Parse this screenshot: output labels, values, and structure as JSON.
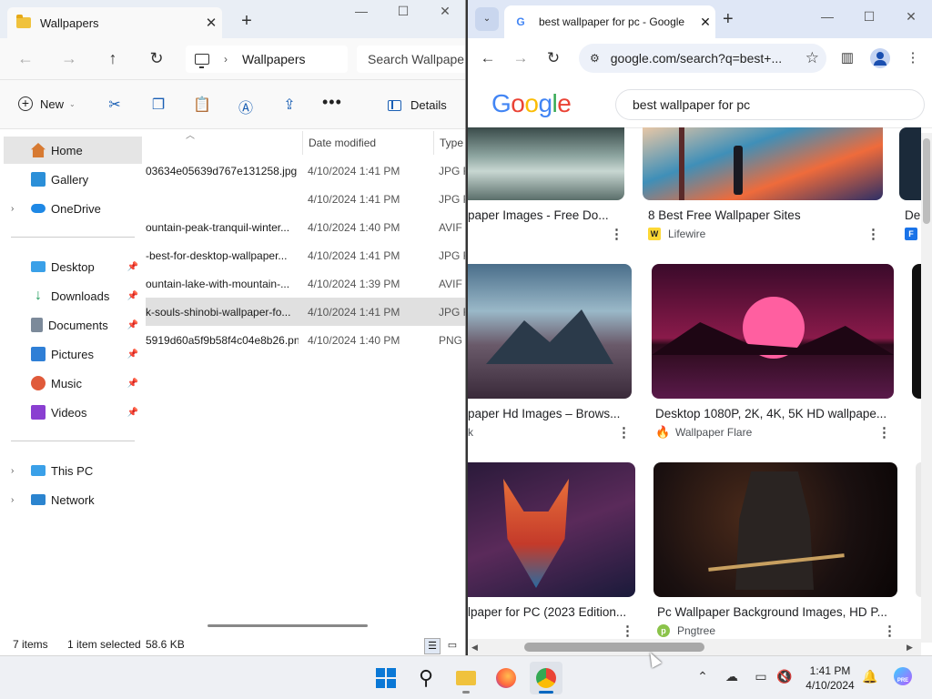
{
  "explorer": {
    "tab_title": "Wallpapers",
    "address": {
      "location": "Wallpapers",
      "search_placeholder": "Search Wallpapers"
    },
    "commands": {
      "new_label": "New",
      "details_label": "Details"
    },
    "nav_pane": {
      "items": [
        {
          "label": "Home",
          "icon": "home-icon"
        },
        {
          "label": "Gallery",
          "icon": "gallery-icon"
        },
        {
          "label": "OneDrive",
          "icon": "onedrive-icon"
        },
        {
          "label": "Desktop",
          "icon": "desktop-icon"
        },
        {
          "label": "Downloads",
          "icon": "downloads-icon"
        },
        {
          "label": "Documents",
          "icon": "documents-icon"
        },
        {
          "label": "Pictures",
          "icon": "pictures-icon"
        },
        {
          "label": "Music",
          "icon": "music-icon"
        },
        {
          "label": "Videos",
          "icon": "videos-icon"
        },
        {
          "label": "This PC",
          "icon": "pc-icon"
        },
        {
          "label": "Network",
          "icon": "network-icon"
        }
      ]
    },
    "columns": {
      "date": "Date modified",
      "type": "Type"
    },
    "files": [
      {
        "name": "03634e05639d767e131258.jpg",
        "date": "4/10/2024 1:41 PM",
        "type": "JPG F"
      },
      {
        "name": "",
        "date": "4/10/2024 1:41 PM",
        "type": "JPG F"
      },
      {
        "name": "ountain-peak-tranquil-winter...",
        "date": "4/10/2024 1:40 PM",
        "type": "AVIF"
      },
      {
        "name": "-best-for-desktop-wallpaper...",
        "date": "4/10/2024 1:41 PM",
        "type": "JPG F"
      },
      {
        "name": "ountain-lake-with-mountain-...",
        "date": "4/10/2024 1:39 PM",
        "type": "AVIF"
      },
      {
        "name": "k-souls-shinobi-wallpaper-fo...",
        "date": "4/10/2024 1:41 PM",
        "type": "JPG F"
      },
      {
        "name": "5919d60a5f9b58f4c04e8b26.png",
        "date": "4/10/2024 1:40 PM",
        "type": "PNG"
      }
    ],
    "status": {
      "items": "7 items",
      "selected": "1 item selected",
      "size": "58.6 KB"
    }
  },
  "chrome": {
    "tab_title": "best wallpaper for pc - Google",
    "url": "google.com/search?q=best+...",
    "logo": "Google",
    "query": "best wallpaper for pc",
    "results": [
      {
        "title": "paper Images - Free Do...",
        "source": ""
      },
      {
        "title": "8 Best Free Wallpaper Sites",
        "source": "Lifewire"
      },
      {
        "title": "De",
        "source": ""
      },
      {
        "title": "paper Hd Images – Brows...",
        "source": "k"
      },
      {
        "title": "Desktop 1080P, 2K, 4K, 5K HD wallpape...",
        "source": "Wallpaper Flare"
      },
      {
        "title": "lpaper for PC (2023 Edition...",
        "source": ""
      },
      {
        "title": "Pc Wallpaper Background Images, HD P...",
        "source": "Pngtree"
      }
    ]
  },
  "taskbar": {
    "apps": [
      "start-icon",
      "search-icon",
      "file-explorer-icon",
      "firefox-icon",
      "chrome-icon"
    ],
    "clock": {
      "time": "1:41 PM",
      "date": "4/10/2024"
    },
    "badge": "PRE"
  }
}
